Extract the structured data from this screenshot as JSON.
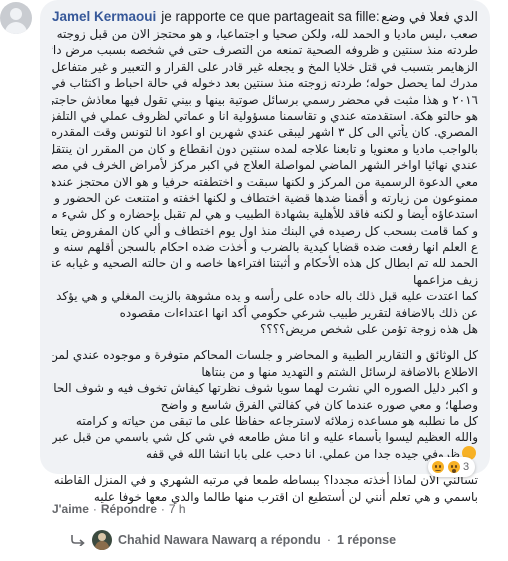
{
  "comment": {
    "author": "Jamel Kermaoui",
    "opening_latin": "je rapporte ce que partageait sa fille:",
    "opening_arabic": "الدي فعلا في وضع",
    "lines": [
      "صعب ،ليس ماديا و الحمد لله، ولكن صحيا و اجتماعيا، و هو محتجز الان من قبل زوجته بعد ان",
      "طردته منذ سنتين و ظروفه الصحية تمنعه من التصرف حتى في شخصه بسبب مرض دائم بشبه",
      "الزهايمر بتسبب في قتل خلايا المخ و يجعله غير قادر على القرار و التعبير و غير متفاعل ولا",
      "مدرك لما يحصل حوله؛ طردته زوجته منذ سنتين بعد دخوله في حالة احباط و اكتئاب في ديسمبر",
      "٢٠١٦ و هذا مثبت في محضر رسمي برسائل صوتية بينها و بيني تقول فيها معاذش حاجتي بيه و",
      "هو حالتو هكة. استقدمته عندي و تقاسمنا مسؤولية انا و عماتي لظروف عملي في التلفزيون",
      "المصري. كان يأتي الى كل ٣ اشهر ليبقى عندي شهرين او اعود انا لتونس وقت المقدره. قمنا",
      "بالواجب ماديا و معنويا و تابعنا علاجه لمده سنتين دون انقطاع و كان من المقرر ان ينتقل للعيش",
      "عندي نهائيا اواخر الشهر الماضي لمواصلة العلاج في اكبر مركز لأمراض الخرف في مصر و",
      "معي الدعوة الرسمية من المركز و لكنها سبقت و اختطفته حرفيا و هو الان محتجز عندها و نحن",
      "ممنوعون من زيارته و أقمنا ضدها قضية اختطاف و لكنها اخفته و امتنعت عن الحضور و تم",
      "استدعاؤه أيضا و لكنه فاقد للأهلية بشهادة الطبيب و هي لم تقبل بإحضاره و كل شيء مثبت رسميا .",
      "و كما قامت بسحب كل رصيده في البنك منذ اول يوم اختطاف و ألي كان المفروض يتعالج بيه",
      "ع العلم انها رفعت ضده قضايا كيدية بالضرب و أخذت ضده احكام بالسجن أقلهم سنه و لكن",
      "الحمد لله تم ابطال كل هذه الأحكام و أثبتنا افتراءها خاصه و ان حالته الصحيه و غيابه عنها يؤكدان",
      "زيف مزاعمها"
    ],
    "paragraph2": [
      "كما اعتدت عليه قبل ذلك باله حاده على رأسه و يده مشوهة بالزيت المغلي و هي يؤكد انها المسؤوله",
      "عن ذلك بالاضافة لتقرير طبيب شرعي حكومي أكد انها اعتداءات مقصوده",
      "هل هذه زوجة تؤمن على شخص مريض؟؟؟؟"
    ],
    "paragraph3": [
      "كل الوثائق و التقارير الطبية و المحاضر و جلسات المحاكم متوفرة و موجوده عندي لمن أراد",
      "الاطلاع بالاضافة لرسائل الشتم و التهديد منها و من بنتاها",
      "و اكبر دليل الصوره الي نشرت لهما سويا شوف نظرتها كيفاش تخوف فيه و شوف الحاله الي هو",
      "وصلها؛ و معي صوره عندما كان في كفالتي الفرق شاسع و واضح",
      "كل ما نطلبه هو مساعده زملائه لاسترجاعه حفاظا على ما تبقى من حياته و كرامته",
      "والله العظيم ليسوا بأسماء عليه و انا مش طامعه في شي كل شي باسمي من قبل عبر إلي",
      "ظروفي جيده جدا من عملي. انا دحب على بابا انشا الله في قفه"
    ],
    "paragraph4": [
      "تسألني الان لماذا أخذته مجددا؟ ببساطه طمعا في مرتبه الشهري و في المنزل القاطنه به لانه مسجل",
      "باسمي و هي تعلم أنني لن أستطيع ان اقترب منها طالما والدي معها خوفا عليه"
    ],
    "reaction_count": "3"
  },
  "actions": {
    "like": "J'aime",
    "reply": "Répondre",
    "time": "7 h"
  },
  "replies": {
    "name": "Chahid Nawara Nawarq a répondu",
    "count": "1 réponse"
  },
  "colors": {
    "bubble": "#f0f2f5",
    "author": "#365899",
    "meta": "#65676b",
    "reaction": "#f7b125"
  }
}
